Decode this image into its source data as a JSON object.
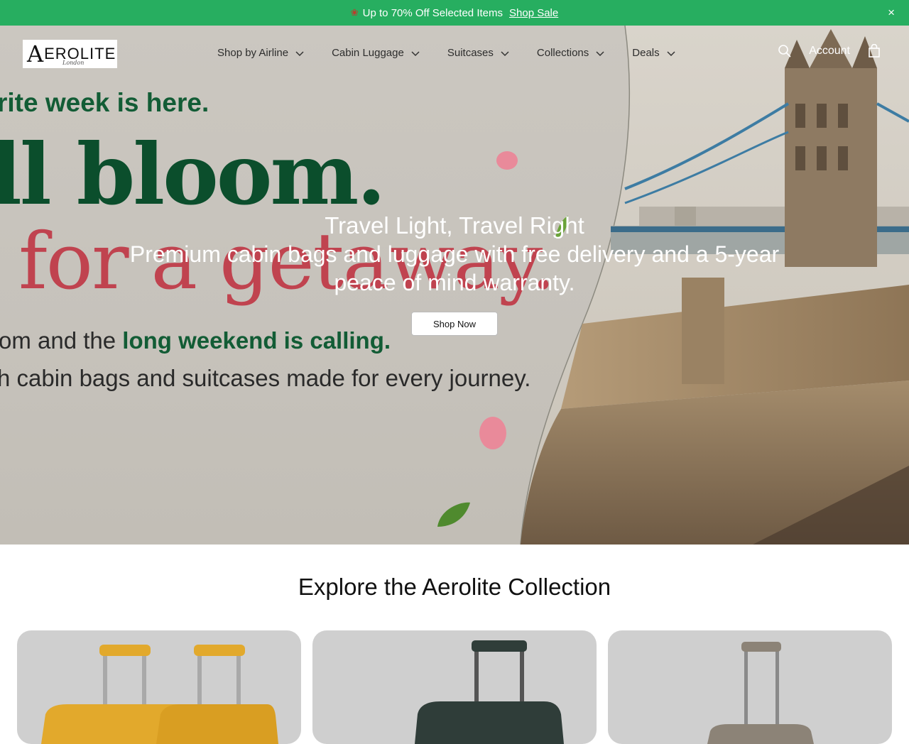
{
  "announcement": {
    "text": "Up to 70% Off Selected Items",
    "link": "Shop Sale",
    "close": "×",
    "icon": "bow-icon"
  },
  "header": {
    "logo": {
      "mark": "A",
      "text": "EROLITE",
      "sub": "London"
    },
    "nav": [
      {
        "label": "Shop by Airline"
      },
      {
        "label": "Cabin Luggage"
      },
      {
        "label": "Suitcases"
      },
      {
        "label": "Collections"
      },
      {
        "label": "Deals"
      }
    ],
    "account": "Account",
    "icons": [
      "search-icon",
      "bag-icon"
    ]
  },
  "hero": {
    "poster": {
      "line1": "rite week is here.",
      "line2": "ll bloom.",
      "line3": "for a getaway.",
      "line4_a": "om and the ",
      "line4_b": "long weekend is calling.",
      "line5": "h cabin bags and suitcases made for every journey."
    },
    "title": "Travel Light, Travel Right",
    "subtitle": "Premium cabin bags and luggage with free delivery and a 5-year peace of mind warranty.",
    "cta": "Shop Now"
  },
  "collection": {
    "title": "Explore the Aerolite Collection",
    "cards": [
      {
        "name": "yellow-suitcases",
        "color": "#e2a92c"
      },
      {
        "name": "green-suitcase",
        "color": "#2f3d39"
      },
      {
        "name": "grey-suitcase",
        "color": "#8c8377"
      }
    ]
  },
  "colors": {
    "announcement_bg": "#27ae60",
    "poster_green": "#0b4e2c",
    "poster_red": "#c0434f"
  }
}
